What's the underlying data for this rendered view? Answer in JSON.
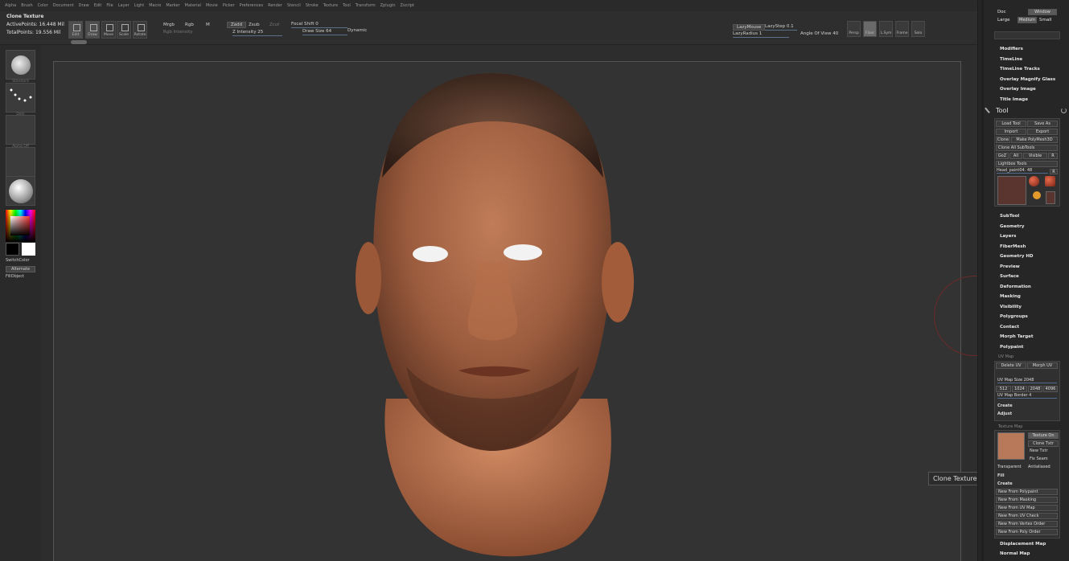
{
  "menubar": {
    "items": [
      "Alpha",
      "Brush",
      "Color",
      "Document",
      "Draw",
      "Edit",
      "File",
      "Layer",
      "Light",
      "Macro",
      "Marker",
      "Material",
      "Movie",
      "Picker",
      "Preferences",
      "Render",
      "Stencil",
      "Stroke",
      "Texture",
      "Tool",
      "Transform",
      "Zplugin",
      "Zscript"
    ]
  },
  "info": {
    "title": "Clone Texture",
    "active_points": "ActivePoints: 16.448 Mil",
    "total_points": "TotalPoints: 19.556 Mil"
  },
  "toolbar": {
    "edit": "Edit",
    "draw": "Draw",
    "move": "Move",
    "scale": "Scale",
    "rotate": "Rotate",
    "mrgb": "Mrgb",
    "rgb": "Rgb",
    "m": "M",
    "zadd": "Zadd",
    "zsub": "Zsub",
    "zcut": "Zcut",
    "rgb_intensity": "Rgb Intensity",
    "z_intensity": "Z Intensity 25",
    "focal_shift": "Focal Shift 0",
    "draw_size": "Draw Size 64",
    "dynamic": "Dynamic",
    "lazymouse": "LazyMouse",
    "lazystep": "LazyStep 0.1",
    "lazyradius": "LazyRadius 1",
    "angle_of_view": "Angle Of View 40",
    "persp": "Persp",
    "floor": "Floor",
    "lsym": "L.Sym",
    "frame": "Frame",
    "solo": "Solo"
  },
  "left": {
    "standard": "Standard",
    "dots": "Dots",
    "alpha_off": "Alpha Off",
    "texture_off": "Texture Off",
    "material": "Material",
    "switch_color": "SwitchColor",
    "alternate": "Alternate",
    "fill_object": "FillObject"
  },
  "right": {
    "doc": "Doc",
    "window": "Window",
    "large": "Large",
    "medium": "Medium",
    "small": "Small",
    "menus1": [
      "Modifiers",
      "TimeLine",
      "TimeLine Tracks",
      "Overlay Magnify Glass",
      "Overlay Image",
      "Title Image"
    ],
    "tool": "Tool",
    "load_tool": "Load Tool",
    "save_as": "Save As",
    "import": "Import",
    "export": "Export",
    "clone": "Clone",
    "make_polymesh": "Make PolyMesh3D",
    "clone_all": "Clone All SubTools",
    "goz": "GoZ",
    "all": "All",
    "visible": "Visible",
    "r": "R",
    "lightbox_tools": "Lightbox Tools",
    "head_paint": "Head_paint04. 48",
    "menus2": [
      "SubTool",
      "Geometry",
      "Layers",
      "FiberMesh",
      "Geometry HD",
      "Preview",
      "Surface",
      "Deformation",
      "Masking",
      "Visibility",
      "Polygroups",
      "Contact",
      "Morph Target",
      "Polypaint"
    ],
    "uv_map": "UV Map",
    "delete_uv": "Delete UV",
    "morph_uv": "Morph UV",
    "uv_map_size": "UV Map Size 2048",
    "sizes": [
      "512",
      "1024",
      "2048",
      "4096"
    ],
    "uv_map_border": "UV Map Border 4",
    "create": "Create",
    "adjust": "Adjust",
    "texture_map": "Texture Map",
    "texture_on": "Texture On",
    "clone_txtr": "Clone Txtr",
    "new_txtr": "New Txtr",
    "fix_seam": "Fix Seam",
    "transparent": "Transparent",
    "antialiased": "Antialiased",
    "fill": "Fill",
    "create2": "Create",
    "new_from": [
      "New From Polypaint",
      "New From Masking",
      "New From UV Map",
      "New From UV Check",
      "New From Vertex Order",
      "New From Poly Order"
    ],
    "displacement_map": "Displacement Map",
    "normal_map": "Normal Map"
  },
  "tooltip": "Clone Texture"
}
